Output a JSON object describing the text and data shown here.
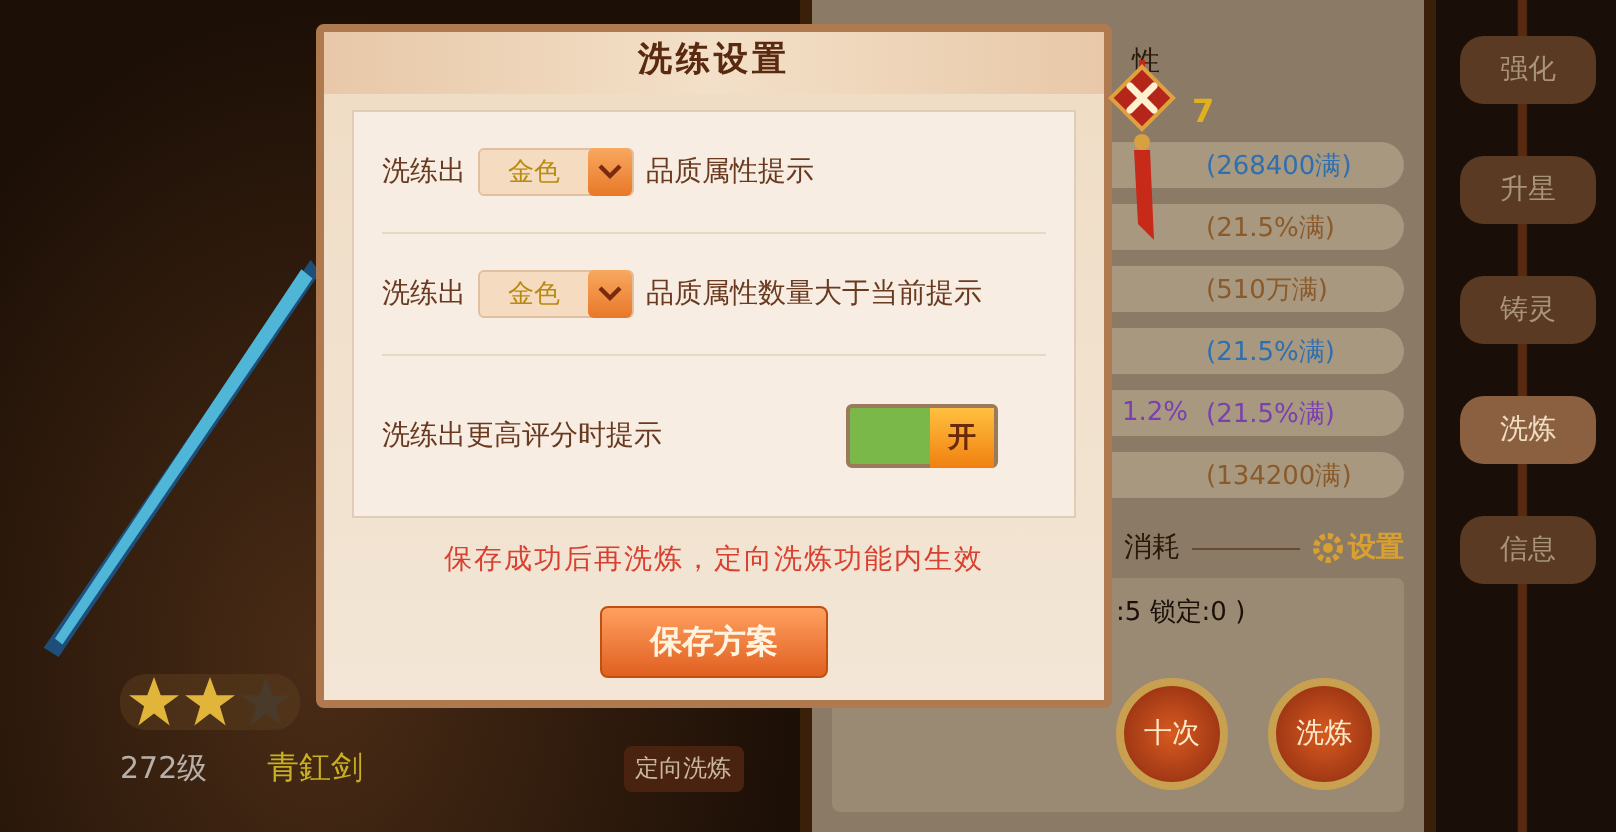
{
  "background": {
    "equipment": {
      "stars": 2,
      "level": "272级",
      "name": "青釭剑",
      "targeted_button": "定向洗炼"
    },
    "panel": {
      "header": "性",
      "score": "7",
      "stats": [
        {
          "max": "(268400满)",
          "color": "#2e6fb0"
        },
        {
          "max": "(21.5%满)",
          "color": "#8a5a2a"
        },
        {
          "max": "(510万满)",
          "color": "#8a5a2a"
        },
        {
          "max": "(21.5%满)",
          "color": "#2e6fb0"
        },
        {
          "value": "1.2%",
          "max": "(21.5%满)",
          "color": "#7a3fb0"
        },
        {
          "max": "(134200满)",
          "color": "#8a5a2a"
        }
      ],
      "cost_label": "消耗",
      "settings_link": "设置",
      "lock_info": ":5 锁定:0 )",
      "buttons": [
        "十次",
        "洗炼"
      ]
    },
    "tabs": [
      {
        "label": "强化",
        "selected": false
      },
      {
        "label": "升星",
        "selected": false
      },
      {
        "label": "铸灵",
        "selected": false
      },
      {
        "label": "洗炼",
        "selected": true
      },
      {
        "label": "信息",
        "selected": false
      }
    ]
  },
  "dialog": {
    "title": "洗练设置",
    "rows": [
      {
        "kind": "dropdown",
        "prefix": "洗练出",
        "value": "金色",
        "suffix": "品质属性提示"
      },
      {
        "kind": "dropdown",
        "prefix": "洗练出",
        "value": "金色",
        "suffix": "品质属性数量大于当前提示"
      },
      {
        "kind": "toggle",
        "label": "洗练出更高评分时提示",
        "on": true,
        "toggle_label": "开"
      }
    ],
    "note": "保存成功后再洗炼，定向洗炼功能内生效",
    "save_button": "保存方案"
  }
}
